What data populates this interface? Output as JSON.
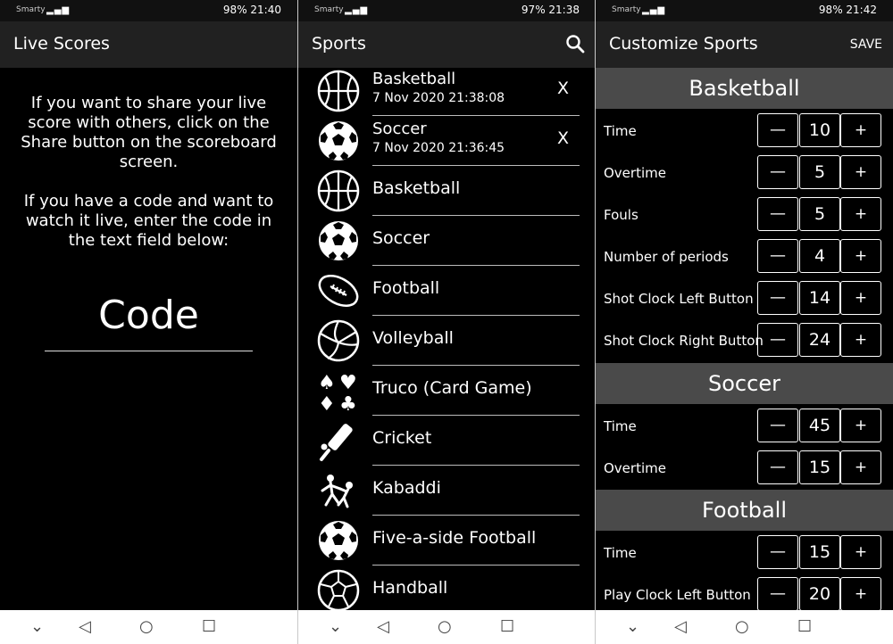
{
  "status": {
    "s1": {
      "carrier": "Smarty",
      "right": "98%  21:40"
    },
    "s2": {
      "carrier": "Smarty",
      "right": "97%  21:38"
    },
    "s3": {
      "carrier": "Smarty",
      "right": "98%  21:42"
    }
  },
  "screen1": {
    "title": "Live Scores",
    "para1": "If you want to share your live score with others, click on the Share button on the scoreboard screen.",
    "para2": "If you have a code and want to watch it live, enter the code in the text field below:",
    "code_placeholder": "Code"
  },
  "screen2": {
    "title": "Sports",
    "recent": [
      {
        "name": "Basketball",
        "date": "7 Nov 2020 21:38:08",
        "close": "X",
        "icon": "basketball-icon"
      },
      {
        "name": "Soccer",
        "date": "7 Nov 2020 21:36:45",
        "close": "X",
        "icon": "soccer-ball-icon"
      }
    ],
    "sports": [
      {
        "label": "Basketball",
        "icon": "basketball-icon"
      },
      {
        "label": "Soccer",
        "icon": "soccer-ball-icon"
      },
      {
        "label": "Football",
        "icon": "american-football-icon"
      },
      {
        "label": "Volleyball",
        "icon": "volleyball-icon"
      },
      {
        "label": "Truco (Card Game)",
        "icon": "card-suits-icon"
      },
      {
        "label": "Cricket",
        "icon": "cricket-bat-icon"
      },
      {
        "label": "Kabaddi",
        "icon": "kabaddi-icon"
      },
      {
        "label": "Five-a-side Football",
        "icon": "soccer-ball-icon"
      },
      {
        "label": "Handball",
        "icon": "handball-icon"
      }
    ]
  },
  "screen3": {
    "title": "Customize Sports",
    "save": "SAVE",
    "minus": "—",
    "plus": "+",
    "sections": [
      {
        "name": "Basketball",
        "settings": [
          {
            "label": "Time",
            "value": "10"
          },
          {
            "label": "Overtime",
            "value": "5"
          },
          {
            "label": "Fouls",
            "value": "5"
          },
          {
            "label": "Number of periods",
            "value": "4"
          },
          {
            "label": "Shot Clock Left Button",
            "value": "14"
          },
          {
            "label": "Shot Clock Right Button",
            "value": "24"
          }
        ]
      },
      {
        "name": "Soccer",
        "settings": [
          {
            "label": "Time",
            "value": "45"
          },
          {
            "label": "Overtime",
            "value": "15"
          }
        ]
      },
      {
        "name": "Football",
        "settings": [
          {
            "label": "Time",
            "value": "15"
          },
          {
            "label": "Play Clock Left Button",
            "value": "20"
          }
        ]
      }
    ]
  },
  "navbar": {
    "back": "◁",
    "home": "○",
    "recents": "☐",
    "down": "⌄"
  }
}
